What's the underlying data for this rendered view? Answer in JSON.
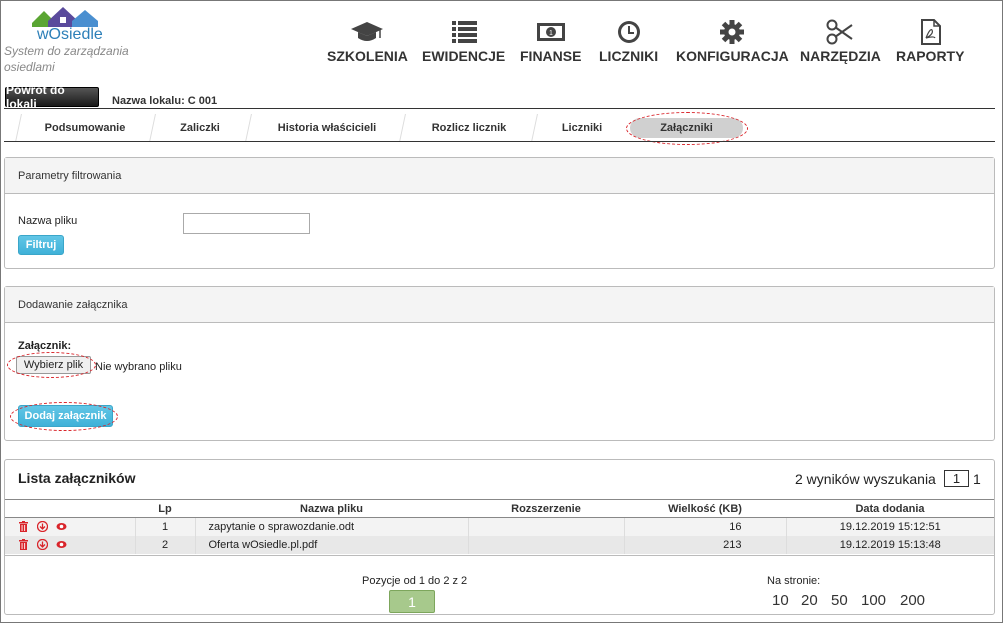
{
  "app": {
    "brand": "wOsiedle",
    "tagline": "System do zarządzania osiedlami"
  },
  "nav": [
    {
      "label": "SZKOLENIA",
      "icon": "graduation-cap-icon"
    },
    {
      "label": "EWIDENCJE",
      "icon": "list-icon"
    },
    {
      "label": "FINANSE",
      "icon": "money-icon"
    },
    {
      "label": "LICZNIKI",
      "icon": "clock-icon"
    },
    {
      "label": "KONFIGURACJA",
      "icon": "gear-icon"
    },
    {
      "label": "NARZĘDZIA",
      "icon": "scissors-icon"
    },
    {
      "label": "RAPORTY",
      "icon": "pdf-file-icon"
    }
  ],
  "back_button": "Powrót do lokali",
  "unit_label": "Nazwa lokalu: C 001",
  "tabs": [
    {
      "label": "Podsumowanie"
    },
    {
      "label": "Zaliczki"
    },
    {
      "label": "Historia właścicieli"
    },
    {
      "label": "Rozlicz licznik"
    },
    {
      "label": "Liczniki"
    },
    {
      "label": "Załączniki",
      "active": true
    }
  ],
  "filter": {
    "title": "Parametry filtrowania",
    "file_name_label": "Nazwa pliku",
    "file_name_value": "",
    "button": "Filtruj"
  },
  "upload": {
    "title": "Dodawanie załącznika",
    "field_label": "Załącznik:",
    "choose_button": "Wybierz plik",
    "no_file_text": "Nie wybrano pliku",
    "submit_button": "Dodaj załącznik"
  },
  "list": {
    "title": "Lista załączników",
    "results_text": "2 wyników wyszukania",
    "current_page": "1",
    "total_pages": "1",
    "columns": [
      "Lp",
      "Nazwa pliku",
      "Rozszerzenie",
      "Wielkość (KB)",
      "Data dodania"
    ],
    "rows": [
      {
        "lp": "1",
        "name": "zapytanie o sprawozdanie.odt",
        "ext": "",
        "size": "16",
        "date": "19.12.2019 15:12:51"
      },
      {
        "lp": "2",
        "name": "Oferta wOsiedle.pl.pdf",
        "ext": "",
        "size": "213",
        "date": "19.12.2019 15:13:48"
      }
    ],
    "row_actions": [
      "trash-icon",
      "download-icon",
      "eye-icon"
    ],
    "position_text": "Pozycje od 1 do 2 z 2",
    "page_button": "1",
    "per_page_label": "Na stronie:",
    "per_page_options": [
      "10",
      "20",
      "50",
      "100",
      "200"
    ]
  },
  "colors": {
    "accent": "#4bb8de",
    "annotation": "#d9252b",
    "pager": "#a7c98c",
    "logo_green": "#5aa532",
    "logo_purple": "#5a4a9c"
  }
}
